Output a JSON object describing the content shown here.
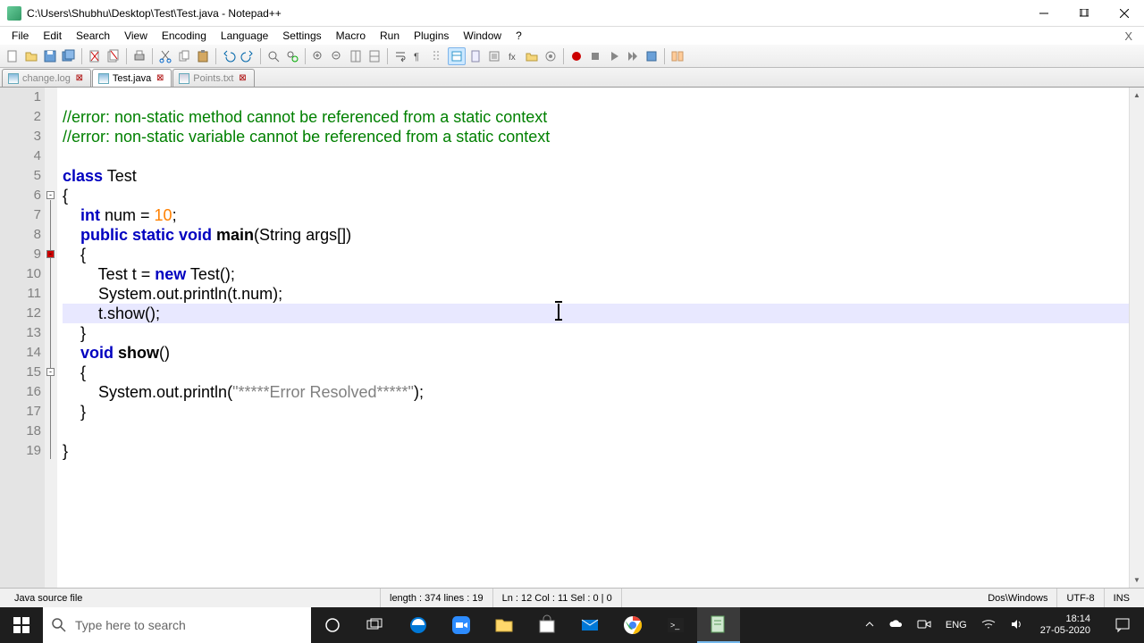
{
  "window": {
    "title": "C:\\Users\\Shubhu\\Desktop\\Test\\Test.java - Notepad++"
  },
  "menu": {
    "items": [
      "File",
      "Edit",
      "Search",
      "View",
      "Encoding",
      "Language",
      "Settings",
      "Macro",
      "Run",
      "Plugins",
      "Window",
      "?"
    ],
    "close": "X"
  },
  "tabs": {
    "t0": "change.log",
    "t1": "Test.java",
    "t2": "Points.txt"
  },
  "code": {
    "l1": "",
    "l2_a": "//error: non-static method cannot be referenced from a static context",
    "l3_a": "//error: non-static variable cannot be referenced from a static context",
    "l4": "",
    "l5_class": "class",
    "l5_name": " Test",
    "l6": "{",
    "l7_int": "    int",
    "l7_rest": " num = ",
    "l7_num": "10",
    "l7_semi": ";",
    "l8_pub": "    public static void",
    "l8_main": " main",
    "l8_args": "(String args[])",
    "l9": "    {",
    "l10_a": "        Test t = ",
    "l10_new": "new",
    "l10_b": " Test();",
    "l11": "        System.out.println(t.num);",
    "l12": "        t.show();",
    "l13": "    }",
    "l14_void": "    void",
    "l14_show": " show",
    "l14_p": "()",
    "l15": "    {",
    "l16_a": "        System.out.println(",
    "l16_str": "\"*****Error Resolved*****\"",
    "l16_b": ");",
    "l17": "    }",
    "l18": "",
    "l19": "}"
  },
  "status": {
    "filetype": "Java source file",
    "length": "length : 374    lines : 19",
    "pos": "Ln : 12    Col : 11    Sel : 0 | 0",
    "eol": "Dos\\Windows",
    "enc": "UTF-8",
    "ins": "INS"
  },
  "taskbar": {
    "search_placeholder": "Type here to search",
    "lang": "ENG",
    "time": "18:14",
    "date": "27-05-2020"
  }
}
